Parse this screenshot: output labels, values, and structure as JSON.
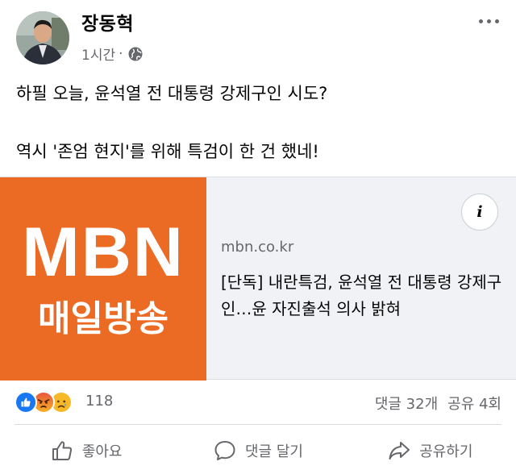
{
  "post": {
    "author": "장동혁",
    "time": "1시간",
    "separator": "·",
    "audience_icon": "globe-icon",
    "more_icon": "more-options-icon",
    "text_line1": "하필 오늘, 윤석열 전 대통령 강제구인 시도?",
    "text_line2": "역시 '존엄 현지'를 위해 특검이 한 건 했네!"
  },
  "link": {
    "logo_main": "MBN",
    "logo_sub": "매일방송",
    "logo_color": "#eb6a24",
    "info_icon": "info-icon",
    "info_label": "i",
    "domain": "mbn.co.kr",
    "title": "[단독] 내란특검, 윤석열 전 대통령 강제구인…윤 자진출석 의사 밝혀"
  },
  "engagement": {
    "reaction_icons": [
      "like-icon",
      "angry-icon",
      "sad-icon"
    ],
    "reaction_count": "118",
    "comments": "댓글 32개",
    "shares": "공유 4회"
  },
  "actions": {
    "like": "좋아요",
    "comment": "댓글 달기",
    "share": "공유하기"
  },
  "colors": {
    "accent_blue": "#1877f2",
    "text_secondary": "#65676b",
    "card_bg": "#f0f2f5"
  }
}
